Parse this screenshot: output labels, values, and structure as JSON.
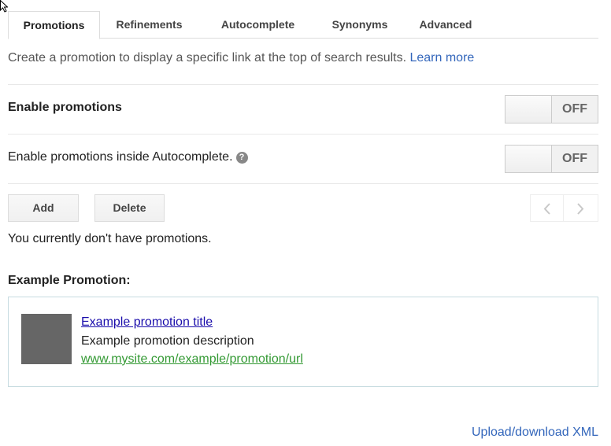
{
  "tabs": [
    {
      "label": "Promotions",
      "active": true
    },
    {
      "label": "Refinements",
      "active": false
    },
    {
      "label": "Autocomplete",
      "active": false
    },
    {
      "label": "Synonyms",
      "active": false
    },
    {
      "label": "Advanced",
      "active": false
    }
  ],
  "intro": {
    "text": "Create a promotion to display a specific link at the top of search results.",
    "link": "Learn more"
  },
  "settings": {
    "enable_promotions": {
      "label": "Enable promotions",
      "state": "OFF"
    },
    "enable_autocomplete": {
      "label": "Enable promotions inside Autocomplete.",
      "help_icon": "question-icon",
      "state": "OFF"
    }
  },
  "actions": {
    "add_label": "Add",
    "delete_label": "Delete",
    "prev_icon": "chevron-left-icon",
    "next_icon": "chevron-right-icon"
  },
  "empty_message": "You currently don't have promotions.",
  "example": {
    "heading": "Example Promotion:",
    "title": "Example promotion title",
    "description": "Example promotion description",
    "url": "www.mysite.com/example/promotion/url"
  },
  "footer": {
    "upload_link": "Upload/download XML"
  },
  "colors": {
    "link": "#3366bb",
    "example_title": "#1a0dab",
    "example_url": "#339933",
    "thumbnail": "#666666"
  }
}
